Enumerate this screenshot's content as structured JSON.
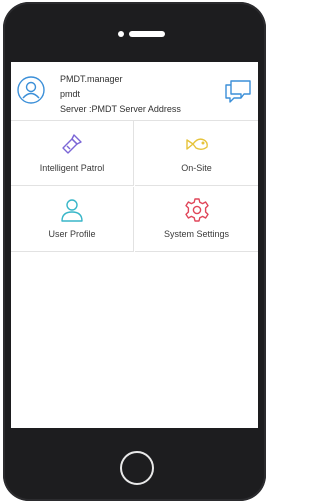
{
  "user": {
    "name": "PMDT.manager",
    "account": "pmdt",
    "server": "Server :PMDT Server Address"
  },
  "menu": [
    {
      "label": "Intelligent Patrol",
      "icon": "flashlight-icon",
      "color": "#7b66d6"
    },
    {
      "label": "On-Site",
      "icon": "fish-icon",
      "color": "#e6c33a"
    },
    {
      "label": "User Profile",
      "icon": "person-icon",
      "color": "#38b6c8"
    },
    {
      "label": "System Settings",
      "icon": "gear-icon",
      "color": "#e0465a"
    }
  ],
  "colors": {
    "accent": "#3b8fd8",
    "frame": "#1d1d1f"
  }
}
